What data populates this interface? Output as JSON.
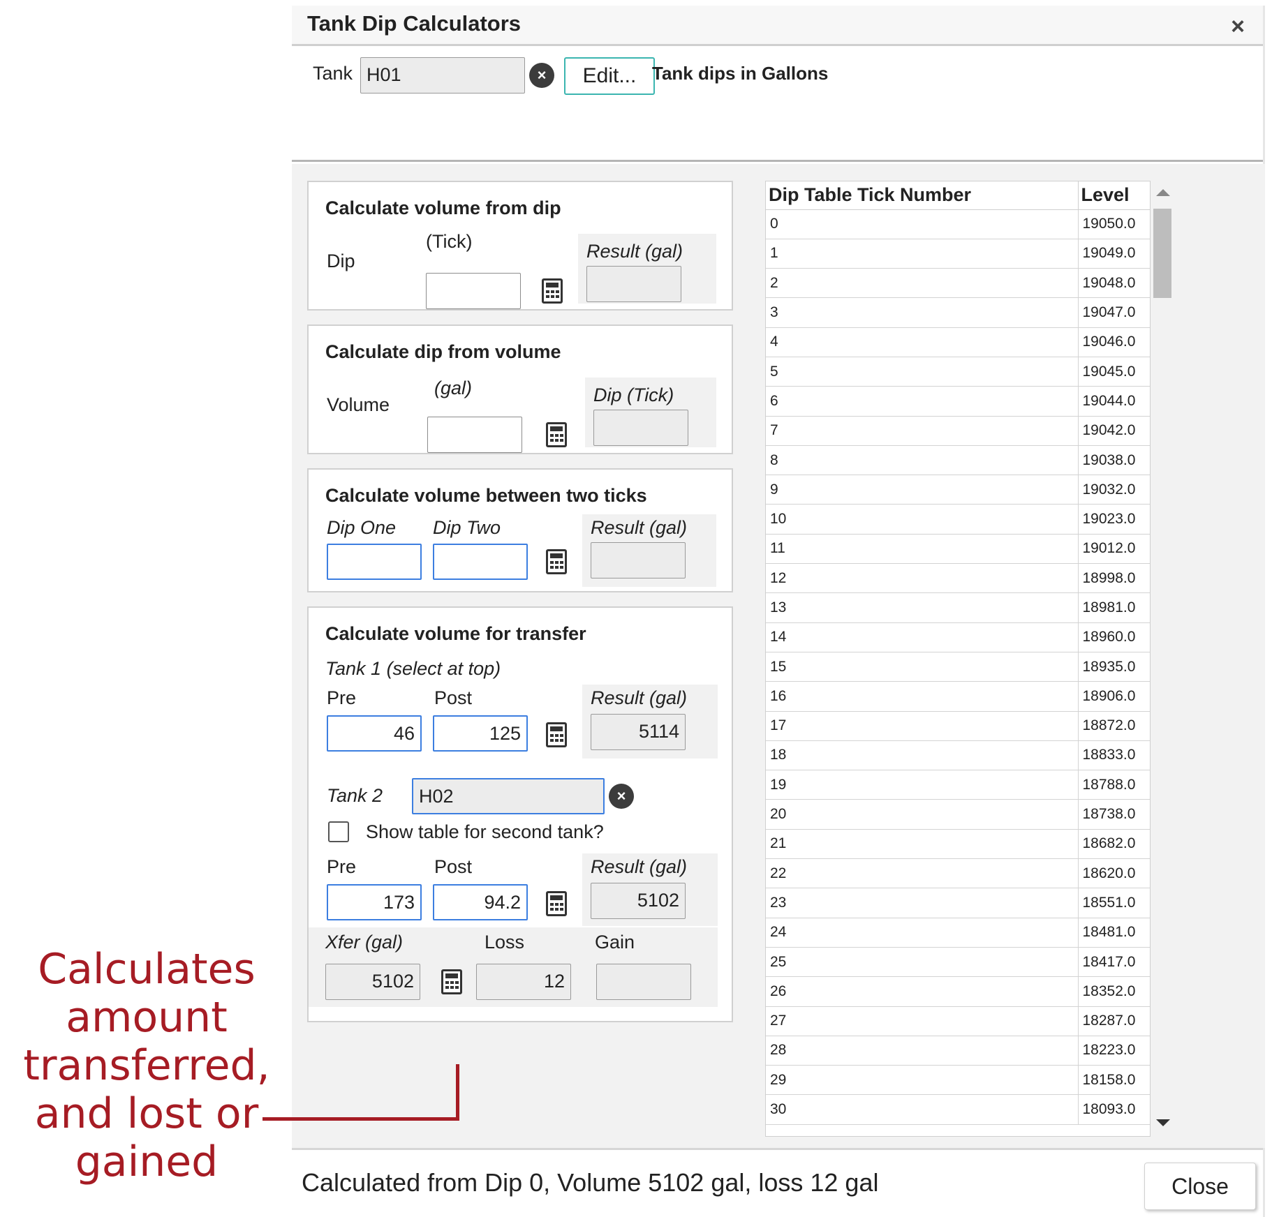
{
  "dialog": {
    "title": "Tank Dip Calculators",
    "close_icon": "×",
    "tank_label": "Tank",
    "tank_value": "H01",
    "clear_icon": "×",
    "edit_label": "Edit...",
    "units_note": "Tank dips in Gallons"
  },
  "panel_volume_from_dip": {
    "title": "Calculate volume from dip",
    "dip_label": "Dip",
    "tick_label": "(Tick)",
    "result_label": "Result (gal)",
    "dip_value": "",
    "result_value": ""
  },
  "panel_dip_from_volume": {
    "title": "Calculate dip from volume",
    "volume_label": "Volume",
    "gal_label": "(gal)",
    "result_label": "Dip (Tick)",
    "volume_value": "",
    "result_value": ""
  },
  "panel_between_ticks": {
    "title": "Calculate volume between two ticks",
    "dip_one_label": "Dip One",
    "dip_two_label": "Dip Two",
    "result_label": "Result (gal)",
    "dip_one_value": "",
    "dip_two_value": "",
    "result_value": ""
  },
  "panel_transfer": {
    "title": "Calculate volume for transfer",
    "tank1_label": "Tank 1 (select at top)",
    "pre_label": "Pre",
    "post_label": "Post",
    "result_label": "Result (gal)",
    "tank1_pre": "46",
    "tank1_post": "125",
    "tank1_result": "5114",
    "tank2_label": "Tank 2",
    "tank2_value": "H02",
    "clear_icon": "×",
    "show_table_label": "Show table for second tank?",
    "show_table_checked": false,
    "tank2_pre": "173",
    "tank2_post": "94.2",
    "tank2_result": "5102",
    "xfer_label": "Xfer (gal)",
    "loss_label": "Loss",
    "gain_label": "Gain",
    "xfer_value": "5102",
    "loss_value": "12",
    "gain_value": ""
  },
  "dip_table": {
    "columns": [
      "Dip Table Tick Number",
      "Level"
    ],
    "rows": [
      [
        "0",
        "19050.0"
      ],
      [
        "1",
        "19049.0"
      ],
      [
        "2",
        "19048.0"
      ],
      [
        "3",
        "19047.0"
      ],
      [
        "4",
        "19046.0"
      ],
      [
        "5",
        "19045.0"
      ],
      [
        "6",
        "19044.0"
      ],
      [
        "7",
        "19042.0"
      ],
      [
        "8",
        "19038.0"
      ],
      [
        "9",
        "19032.0"
      ],
      [
        "10",
        "19023.0"
      ],
      [
        "11",
        "19012.0"
      ],
      [
        "12",
        "18998.0"
      ],
      [
        "13",
        "18981.0"
      ],
      [
        "14",
        "18960.0"
      ],
      [
        "15",
        "18935.0"
      ],
      [
        "16",
        "18906.0"
      ],
      [
        "17",
        "18872.0"
      ],
      [
        "18",
        "18833.0"
      ],
      [
        "19",
        "18788.0"
      ],
      [
        "20",
        "18738.0"
      ],
      [
        "21",
        "18682.0"
      ],
      [
        "22",
        "18620.0"
      ],
      [
        "23",
        "18551.0"
      ],
      [
        "24",
        "18481.0"
      ],
      [
        "25",
        "18417.0"
      ],
      [
        "26",
        "18352.0"
      ],
      [
        "27",
        "18287.0"
      ],
      [
        "28",
        "18223.0"
      ],
      [
        "29",
        "18158.0"
      ],
      [
        "30",
        "18093.0"
      ]
    ]
  },
  "footer": {
    "status_text": "Calculated from Dip 0, Volume 5102 gal, loss 12 gal",
    "close_label": "Close"
  },
  "annotation": {
    "lines": [
      "Calculates",
      "amount",
      "transferred,",
      "and lost or",
      "gained"
    ],
    "color": "#a61c24"
  },
  "colors": {
    "accent_teal": "#3bb5b0",
    "focus_blue": "#3c7ee0",
    "pane_gray": "#f2f2f2"
  }
}
